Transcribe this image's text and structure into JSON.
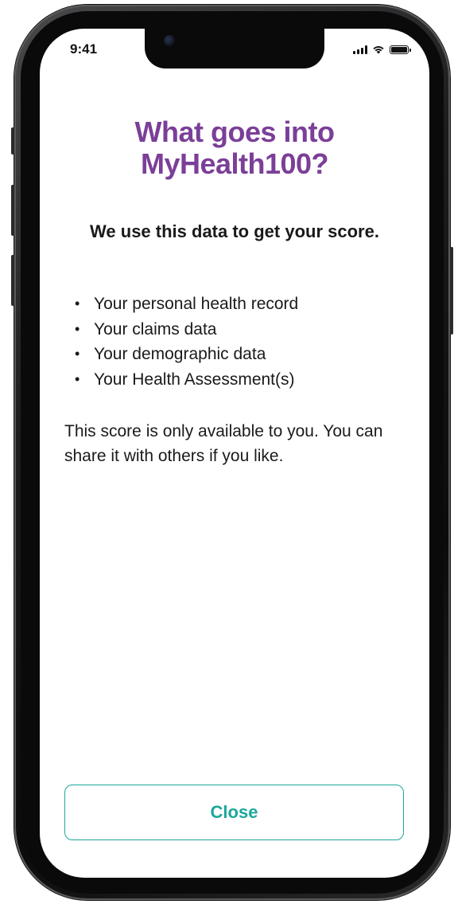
{
  "status_bar": {
    "time": "9:41",
    "icons": [
      "signal-icon",
      "wifi-icon",
      "battery-icon"
    ]
  },
  "content": {
    "title_line1": "What goes into",
    "title_line2": "MyHealth100?",
    "subtitle": "We use this data to get your score.",
    "data_items": [
      "Your personal health record",
      "Your claims data",
      "Your demographic data",
      "Your Health Assessment(s)"
    ],
    "note": "This score is only available to you. You can share it with others if you like."
  },
  "actions": {
    "close_label": "Close"
  },
  "colors": {
    "title": "#7b3f98",
    "accent": "#1ba89a",
    "text": "#1a1a1a"
  }
}
